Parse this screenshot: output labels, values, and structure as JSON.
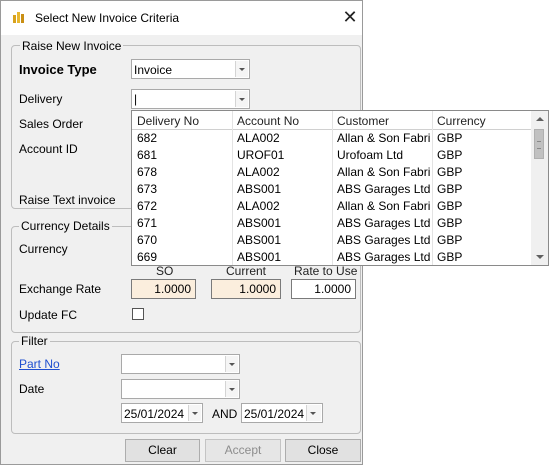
{
  "window": {
    "title": "Select New Invoice Criteria",
    "close_symbol": "✕"
  },
  "raise_group": {
    "legend": "Raise New Invoice",
    "invoice_type_label": "Invoice Type",
    "invoice_type_value": "Invoice",
    "delivery_label": "Delivery",
    "delivery_value": "|",
    "sales_order_label": "Sales Order",
    "account_id_label": "Account ID",
    "raise_text_invoice_label": "Raise Text invoice"
  },
  "currency_group": {
    "legend": "Currency Details",
    "currency_label": "Currency",
    "col_so": "SO",
    "col_current": "Current",
    "col_rate_to_use": "Rate to Use",
    "exchange_rate_label": "Exchange Rate",
    "so_value": "1.0000",
    "current_value": "1.0000",
    "rate_value": "1.0000",
    "update_fc_label": "Update FC"
  },
  "filter_group": {
    "legend": "Filter",
    "part_no_label": "Part No",
    "part_no_value": "",
    "date_label": "Date",
    "date_value": "",
    "date_from": "25/01/2024",
    "and_label": "AND",
    "date_to": "25/01/2024"
  },
  "buttons": {
    "clear": "Clear",
    "accept": "Accept",
    "close": "Close"
  },
  "delivery_dropdown": {
    "columns": [
      "Delivery No",
      "Account No",
      "Customer",
      "Currency"
    ],
    "rows": [
      [
        "682",
        "ALA002",
        "Allan & Son Fabri...",
        "GBP"
      ],
      [
        "681",
        "UROF01",
        "Urofoam Ltd",
        "GBP"
      ],
      [
        "678",
        "ALA002",
        "Allan & Son Fabri...",
        "GBP"
      ],
      [
        "673",
        "ABS001",
        "ABS Garages Ltd",
        "GBP"
      ],
      [
        "672",
        "ALA002",
        "Allan & Son Fabri...",
        "GBP"
      ],
      [
        "671",
        "ABS001",
        "ABS Garages Ltd",
        "GBP"
      ],
      [
        "670",
        "ABS001",
        "ABS Garages Ltd",
        "GBP"
      ],
      [
        "669",
        "ABS001",
        "ABS Garages Ltd",
        "GBP"
      ]
    ]
  },
  "colors": {
    "beige_field": "#fbeedd",
    "link": "#1f4fd0",
    "window_bg": "#f0f0f0"
  }
}
